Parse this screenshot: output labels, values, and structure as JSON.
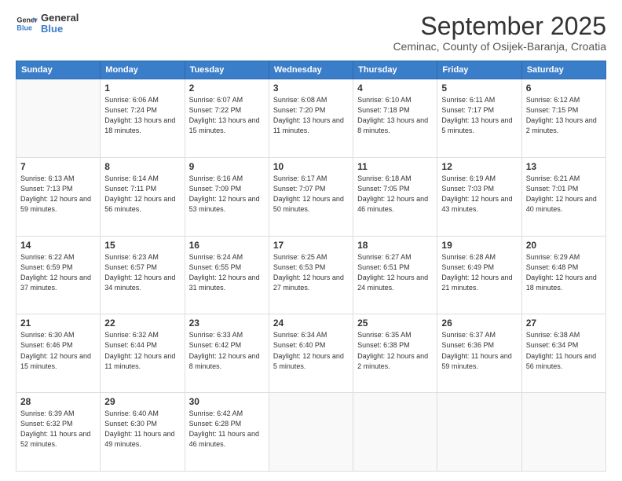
{
  "logo": {
    "line1": "General",
    "line2": "Blue"
  },
  "title": "September 2025",
  "subtitle": "Ceminac, County of Osijek-Baranja, Croatia",
  "days_header": [
    "Sunday",
    "Monday",
    "Tuesday",
    "Wednesday",
    "Thursday",
    "Friday",
    "Saturday"
  ],
  "weeks": [
    [
      {
        "day": "",
        "sunrise": "",
        "sunset": "",
        "daylight": ""
      },
      {
        "day": "1",
        "sunrise": "6:06 AM",
        "sunset": "7:24 PM",
        "daylight": "13 hours and 18 minutes."
      },
      {
        "day": "2",
        "sunrise": "6:07 AM",
        "sunset": "7:22 PM",
        "daylight": "13 hours and 15 minutes."
      },
      {
        "day": "3",
        "sunrise": "6:08 AM",
        "sunset": "7:20 PM",
        "daylight": "13 hours and 11 minutes."
      },
      {
        "day": "4",
        "sunrise": "6:10 AM",
        "sunset": "7:18 PM",
        "daylight": "13 hours and 8 minutes."
      },
      {
        "day": "5",
        "sunrise": "6:11 AM",
        "sunset": "7:17 PM",
        "daylight": "13 hours and 5 minutes."
      },
      {
        "day": "6",
        "sunrise": "6:12 AM",
        "sunset": "7:15 PM",
        "daylight": "13 hours and 2 minutes."
      }
    ],
    [
      {
        "day": "7",
        "sunrise": "6:13 AM",
        "sunset": "7:13 PM",
        "daylight": "12 hours and 59 minutes."
      },
      {
        "day": "8",
        "sunrise": "6:14 AM",
        "sunset": "7:11 PM",
        "daylight": "12 hours and 56 minutes."
      },
      {
        "day": "9",
        "sunrise": "6:16 AM",
        "sunset": "7:09 PM",
        "daylight": "12 hours and 53 minutes."
      },
      {
        "day": "10",
        "sunrise": "6:17 AM",
        "sunset": "7:07 PM",
        "daylight": "12 hours and 50 minutes."
      },
      {
        "day": "11",
        "sunrise": "6:18 AM",
        "sunset": "7:05 PM",
        "daylight": "12 hours and 46 minutes."
      },
      {
        "day": "12",
        "sunrise": "6:19 AM",
        "sunset": "7:03 PM",
        "daylight": "12 hours and 43 minutes."
      },
      {
        "day": "13",
        "sunrise": "6:21 AM",
        "sunset": "7:01 PM",
        "daylight": "12 hours and 40 minutes."
      }
    ],
    [
      {
        "day": "14",
        "sunrise": "6:22 AM",
        "sunset": "6:59 PM",
        "daylight": "12 hours and 37 minutes."
      },
      {
        "day": "15",
        "sunrise": "6:23 AM",
        "sunset": "6:57 PM",
        "daylight": "12 hours and 34 minutes."
      },
      {
        "day": "16",
        "sunrise": "6:24 AM",
        "sunset": "6:55 PM",
        "daylight": "12 hours and 31 minutes."
      },
      {
        "day": "17",
        "sunrise": "6:25 AM",
        "sunset": "6:53 PM",
        "daylight": "12 hours and 27 minutes."
      },
      {
        "day": "18",
        "sunrise": "6:27 AM",
        "sunset": "6:51 PM",
        "daylight": "12 hours and 24 minutes."
      },
      {
        "day": "19",
        "sunrise": "6:28 AM",
        "sunset": "6:49 PM",
        "daylight": "12 hours and 21 minutes."
      },
      {
        "day": "20",
        "sunrise": "6:29 AM",
        "sunset": "6:48 PM",
        "daylight": "12 hours and 18 minutes."
      }
    ],
    [
      {
        "day": "21",
        "sunrise": "6:30 AM",
        "sunset": "6:46 PM",
        "daylight": "12 hours and 15 minutes."
      },
      {
        "day": "22",
        "sunrise": "6:32 AM",
        "sunset": "6:44 PM",
        "daylight": "12 hours and 11 minutes."
      },
      {
        "day": "23",
        "sunrise": "6:33 AM",
        "sunset": "6:42 PM",
        "daylight": "12 hours and 8 minutes."
      },
      {
        "day": "24",
        "sunrise": "6:34 AM",
        "sunset": "6:40 PM",
        "daylight": "12 hours and 5 minutes."
      },
      {
        "day": "25",
        "sunrise": "6:35 AM",
        "sunset": "6:38 PM",
        "daylight": "12 hours and 2 minutes."
      },
      {
        "day": "26",
        "sunrise": "6:37 AM",
        "sunset": "6:36 PM",
        "daylight": "11 hours and 59 minutes."
      },
      {
        "day": "27",
        "sunrise": "6:38 AM",
        "sunset": "6:34 PM",
        "daylight": "11 hours and 56 minutes."
      }
    ],
    [
      {
        "day": "28",
        "sunrise": "6:39 AM",
        "sunset": "6:32 PM",
        "daylight": "11 hours and 52 minutes."
      },
      {
        "day": "29",
        "sunrise": "6:40 AM",
        "sunset": "6:30 PM",
        "daylight": "11 hours and 49 minutes."
      },
      {
        "day": "30",
        "sunrise": "6:42 AM",
        "sunset": "6:28 PM",
        "daylight": "11 hours and 46 minutes."
      },
      {
        "day": "",
        "sunrise": "",
        "sunset": "",
        "daylight": ""
      },
      {
        "day": "",
        "sunrise": "",
        "sunset": "",
        "daylight": ""
      },
      {
        "day": "",
        "sunrise": "",
        "sunset": "",
        "daylight": ""
      },
      {
        "day": "",
        "sunrise": "",
        "sunset": "",
        "daylight": ""
      }
    ]
  ]
}
